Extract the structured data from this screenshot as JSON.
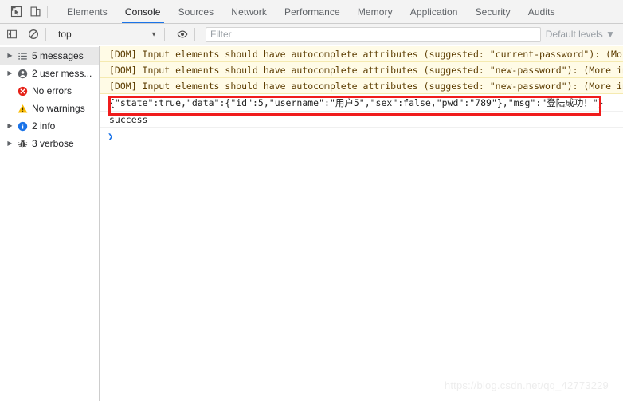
{
  "window": {
    "navy_strip_color": "#0b1338"
  },
  "toolbar": {
    "inspect_icon": "inspect-element-icon",
    "device_icon": "device-toolbar-icon",
    "tabs": [
      {
        "label": "Elements",
        "active": false
      },
      {
        "label": "Console",
        "active": true
      },
      {
        "label": "Sources",
        "active": false
      },
      {
        "label": "Network",
        "active": false
      },
      {
        "label": "Performance",
        "active": false
      },
      {
        "label": "Memory",
        "active": false
      },
      {
        "label": "Application",
        "active": false
      },
      {
        "label": "Security",
        "active": false
      },
      {
        "label": "Audits",
        "active": false
      }
    ],
    "active_tab_underline_color": "#1a73e8"
  },
  "filterbar": {
    "sidebar_toggle_icon": "show-console-sidebar-icon",
    "clear_icon": "clear-console-icon",
    "context_value": "top",
    "context_caret": "▼",
    "eye_icon": "live-expression-eye-icon",
    "filter_placeholder": "Filter",
    "filter_value": "",
    "levels_label": "Default levels ▼"
  },
  "sidebar": {
    "items": [
      {
        "label": "5 messages",
        "icon": "list-icon",
        "arrow": "▶",
        "has_arrow": true,
        "selected": true
      },
      {
        "label": "2 user mess...",
        "icon": "person-icon",
        "arrow": "▶",
        "has_arrow": true,
        "selected": false
      },
      {
        "label": "No errors",
        "icon": "error-icon",
        "arrow": "",
        "has_arrow": false,
        "selected": false
      },
      {
        "label": "No warnings",
        "icon": "warning-icon",
        "arrow": "",
        "has_arrow": false,
        "selected": false
      },
      {
        "label": "2 info",
        "icon": "info-icon",
        "arrow": "▶",
        "has_arrow": true,
        "selected": false
      },
      {
        "label": "3 verbose",
        "icon": "bug-icon",
        "arrow": "▶",
        "has_arrow": true,
        "selected": false
      }
    ]
  },
  "console": {
    "messages": [
      {
        "type": "warn",
        "text": "[DOM] Input elements should have autocomplete attributes (suggested: \"current-password\"): (More"
      },
      {
        "type": "warn",
        "text": "[DOM] Input elements should have autocomplete attributes (suggested: \"new-password\"): (More info"
      },
      {
        "type": "warn",
        "text": "[DOM] Input elements should have autocomplete attributes (suggested: \"new-password\"): (More info"
      },
      {
        "type": "log",
        "text": "{\"state\":true,\"data\":{\"id\":5,\"username\":\"用户5\",\"sex\":false,\"pwd\":\"789\"},\"msg\":\"登陆成功！\"}"
      },
      {
        "type": "log",
        "text": "success"
      }
    ],
    "prompt_symbol": "❯",
    "highlight_color": "#f01c1c"
  },
  "watermark": {
    "text": "https://blog.csdn.net/qq_42773229"
  }
}
